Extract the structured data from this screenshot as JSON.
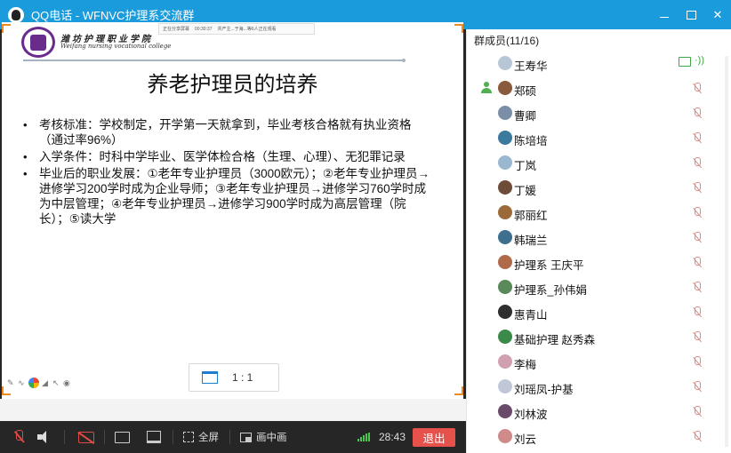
{
  "window": {
    "title": "QQ电话 - WFNVC护理系交流群",
    "buttons": [
      "minimize",
      "maximize",
      "close"
    ]
  },
  "slide": {
    "share_bar": [
      "正在分享屏幕",
      "00:30:37",
      "共产主...于海...等6人正在观看"
    ],
    "school_name_cn": "潍坊护理职业学院",
    "school_name_en": "Weifang nursing vocational college",
    "title": "养老护理员的培养",
    "bullets": [
      "考核标准：学校制定，开学第一天就拿到，毕业考核合格就有执业资格（通过率96%）",
      "入学条件：时科中学毕业、医学体检合格（生理、心理）、无犯罪记录",
      "毕业后的职业发展：①老年专业护理员（3000欧元）；②老年专业护理员→进修学习200学时成为企业导师；③老年专业护理员→进修学习760学时成为中层管理；④老年专业护理员→进修学习900学时成为高层管理（院长）；⑤读大学"
    ],
    "ratio_label": "1 : 1"
  },
  "controls": {
    "fullscreen_label": "全屏",
    "pip_label": "画中画",
    "timer": "28:43",
    "exit_label": "退出",
    "accent_exit": "#e6514b"
  },
  "members": {
    "title": "群成员(11/16)",
    "list": [
      {
        "name": "王寿华",
        "state": "sharing",
        "avatar_color": "#b8c7d6"
      },
      {
        "name": "郑硕",
        "state": "muted",
        "host": true,
        "avatar_color": "#8a5a3c"
      },
      {
        "name": "曹卿",
        "state": "muted",
        "avatar_color": "#7a8fa6"
      },
      {
        "name": "陈培培",
        "state": "muted",
        "avatar_color": "#3a7a9c"
      },
      {
        "name": "丁岚",
        "state": "muted",
        "avatar_color": "#9ab8d0"
      },
      {
        "name": "丁媛",
        "state": "muted",
        "avatar_color": "#6d4c3a"
      },
      {
        "name": "郭丽红",
        "state": "muted",
        "avatar_color": "#9c6a3a"
      },
      {
        "name": "韩瑞兰",
        "state": "muted",
        "avatar_color": "#3f6f8f"
      },
      {
        "name": "护理系  王庆平",
        "state": "muted",
        "avatar_color": "#b06a4a"
      },
      {
        "name": "护理系_孙伟娟",
        "state": "muted",
        "avatar_color": "#5a8a5a"
      },
      {
        "name": "惠青山",
        "state": "muted",
        "avatar_color": "#2f2f2f"
      },
      {
        "name": "基础护理 赵秀森",
        "state": "muted",
        "avatar_color": "#3a8a4a"
      },
      {
        "name": "李梅",
        "state": "muted",
        "avatar_color": "#d0a0b0"
      },
      {
        "name": "刘瑶凤-护基",
        "state": "muted",
        "avatar_color": "#c0c8d8"
      },
      {
        "name": "刘林波",
        "state": "muted",
        "avatar_color": "#6a4a6a"
      },
      {
        "name": "刘云",
        "state": "muted",
        "avatar_color": "#d08a8a"
      }
    ]
  }
}
